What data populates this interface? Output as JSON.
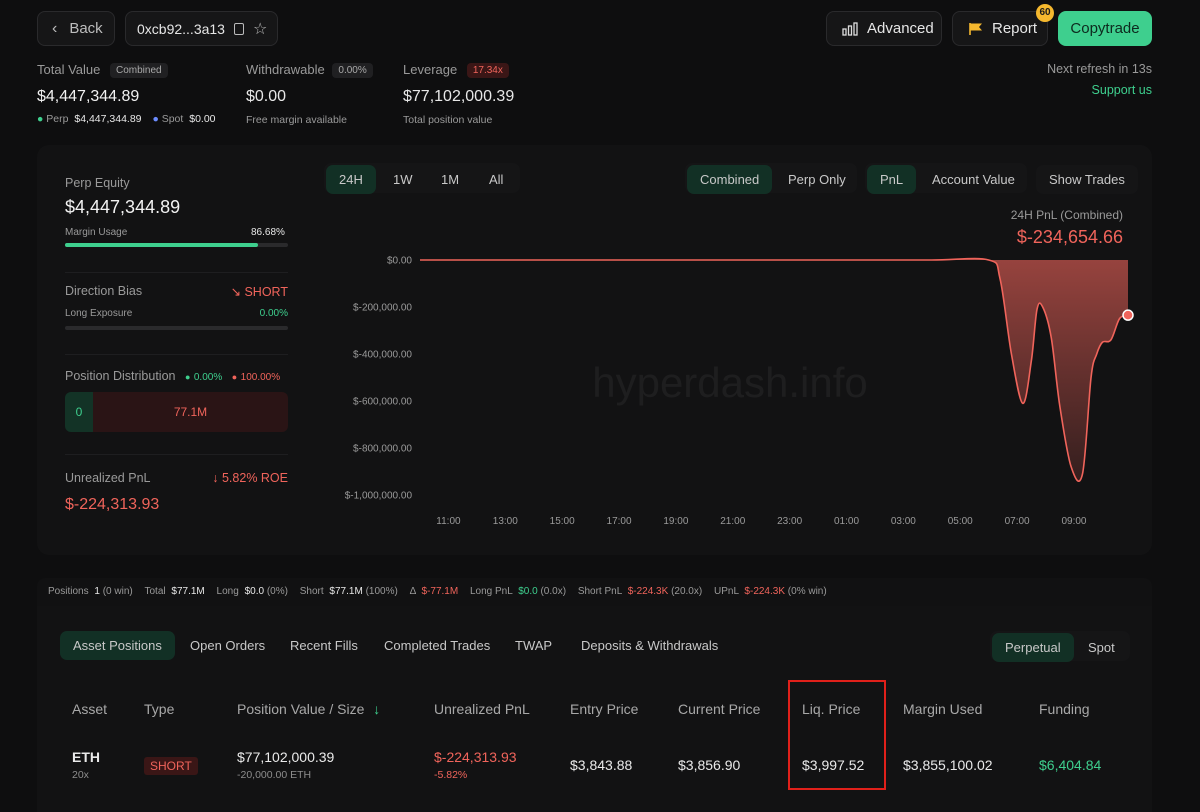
{
  "header": {
    "back_label": "Back",
    "address": "0xcb92...3a13",
    "advanced_label": "Advanced",
    "report_label": "Report",
    "report_badge": "60",
    "copytrade_label": "Copytrade",
    "refresh_text": "Next refresh in 13s",
    "support_text": "Support us"
  },
  "summary": {
    "total_value_label": "Total Value",
    "total_value_tag": "Combined",
    "total_value": "$4,447,344.89",
    "perp_label": "Perp",
    "perp_value": "$4,447,344.89",
    "spot_label": "Spot",
    "spot_value": "$0.00",
    "withdrawable_label": "Withdrawable",
    "withdrawable_tag": "0.00%",
    "withdrawable_value": "$0.00",
    "withdrawable_sub": "Free margin available",
    "leverage_label": "Leverage",
    "leverage_tag": "17.34x",
    "leverage_value": "$77,102,000.39",
    "leverage_sub": "Total position value"
  },
  "left_panel": {
    "perp_equity_label": "Perp Equity",
    "perp_equity_value": "$4,447,344.89",
    "margin_usage_label": "Margin Usage",
    "margin_usage_value": "86.68%",
    "margin_usage_fraction": 0.8668,
    "direction_label": "Direction Bias",
    "direction_value": "SHORT",
    "long_exposure_label": "Long Exposure",
    "long_exposure_value": "0.00%",
    "distribution_label": "Position Distribution",
    "dist_long_pct": "0.00%",
    "dist_short_pct": "100.00%",
    "dist_long_value": "0",
    "dist_short_value": "77.1M",
    "upnl_label": "Unrealized PnL",
    "upnl_roe": "5.82% ROE",
    "upnl_value": "$-224,313.93"
  },
  "chart_controls": {
    "ranges": [
      "24H",
      "1W",
      "1M",
      "All"
    ],
    "modes": [
      "Combined",
      "Perp Only"
    ],
    "metrics": [
      "PnL",
      "Account Value"
    ],
    "show_trades": "Show Trades",
    "watermark": "hyperdash.info"
  },
  "chart_data": {
    "type": "area",
    "title": "24H PnL (Combined)",
    "headline_value": "$-234,654.66",
    "y_ticks": [
      "$0.00",
      "$-200,000.00",
      "$-400,000.00",
      "$-600,000.00",
      "$-800,000.00",
      "$-1,000,000.00"
    ],
    "x_ticks": [
      "11:00",
      "13:00",
      "15:00",
      "17:00",
      "19:00",
      "21:00",
      "23:00",
      "01:00",
      "03:00",
      "05:00",
      "07:00",
      "09:00"
    ],
    "ylim": [
      -1000000,
      0
    ],
    "x_hours": [
      10.0,
      13.0,
      16.0,
      19.0,
      22.0,
      25.0,
      28.0,
      30.0,
      30.4,
      30.8,
      31.2,
      31.5,
      31.7,
      31.9,
      32.2,
      32.5,
      32.9,
      33.3,
      33.6,
      33.8,
      34.0,
      34.3,
      34.6,
      34.9
    ],
    "values": [
      0,
      0,
      0,
      0,
      0,
      0,
      0,
      0,
      -80000,
      -400000,
      -610000,
      -430000,
      -210000,
      -200000,
      -330000,
      -620000,
      -880000,
      -910000,
      -500000,
      -400000,
      -350000,
      -340000,
      -250000,
      -234654
    ],
    "color": "#f0645b"
  },
  "stats_bar": {
    "positions_label": "Positions",
    "positions_value": "1",
    "positions_note": "(0 win)",
    "total_label": "Total",
    "total_value": "$77.1M",
    "long_label": "Long",
    "long_value": "$0.0",
    "long_note": "(0%)",
    "short_label": "Short",
    "short_value": "$77.1M",
    "short_note": "(100%)",
    "delta_label": "Δ",
    "delta_value": "$-77.1M",
    "longpnl_label": "Long PnL",
    "longpnl_value": "$0.0",
    "longpnl_note": "(0.0x)",
    "shortpnl_label": "Short PnL",
    "shortpnl_value": "$-224.3K",
    "shortpnl_note": "(20.0x)",
    "upnl_label": "UPnL",
    "upnl_value": "$-224.3K",
    "upnl_note": "(0% win)"
  },
  "tabs": {
    "items": [
      "Asset Positions",
      "Open Orders",
      "Recent Fills",
      "Completed Trades",
      "TWAP",
      "Deposits & Withdrawals"
    ],
    "market": [
      "Perpetual",
      "Spot"
    ]
  },
  "table": {
    "headers": [
      "Asset",
      "Type",
      "Position Value / Size",
      "Unrealized PnL",
      "Entry Price",
      "Current Price",
      "Liq. Price",
      "Margin Used",
      "Funding"
    ],
    "row": {
      "asset": "ETH",
      "leverage": "20x",
      "type": "SHORT",
      "value": "$77,102,000.39",
      "size": "-20,000.00 ETH",
      "upnl": "$-224,313.93",
      "upnl_pct": "-5.82%",
      "entry": "$3,843.88",
      "current": "$3,856.90",
      "liq": "$3,997.52",
      "margin": "$3,855,100.02",
      "funding": "$6,404.84"
    }
  }
}
